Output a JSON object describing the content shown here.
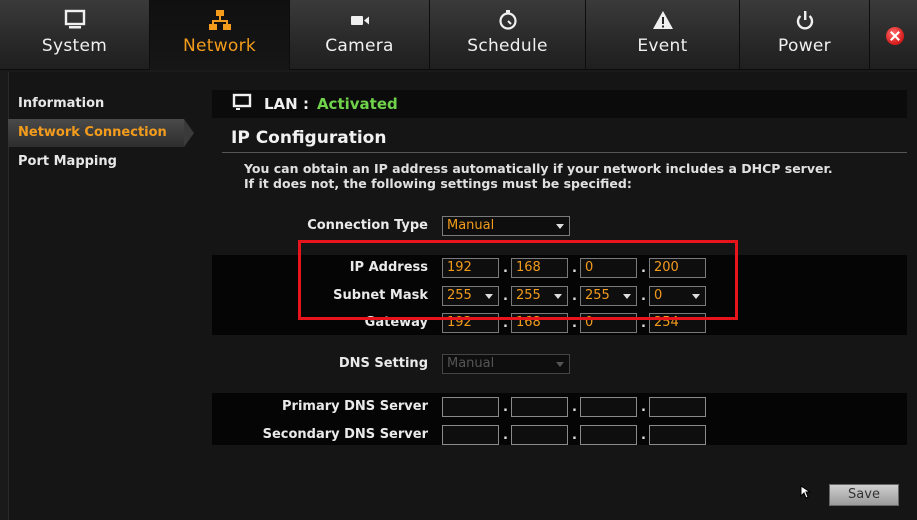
{
  "nav": {
    "tabs": [
      {
        "label": "System",
        "icon": "monitor-icon"
      },
      {
        "label": "Network",
        "icon": "network-icon",
        "active": true
      },
      {
        "label": "Camera",
        "icon": "camera-icon"
      },
      {
        "label": "Schedule",
        "icon": "clock-icon"
      },
      {
        "label": "Event",
        "icon": "warning-icon"
      },
      {
        "label": "Power",
        "icon": "power-icon"
      }
    ],
    "close_icon": "close-icon"
  },
  "sidebar": {
    "items": [
      {
        "label": "Information"
      },
      {
        "label": "Network Connection",
        "active": true
      },
      {
        "label": "Port Mapping"
      }
    ]
  },
  "lan": {
    "label": "LAN :",
    "status": "Activated",
    "status_color": "#6fd24a"
  },
  "ip_config": {
    "title": "IP Configuration",
    "desc_line1": "You can obtain an IP address automatically if your network includes a DHCP server.",
    "desc_line2": "If it does not, the following settings must be specified:",
    "connection_type_label": "Connection Type",
    "connection_type_value": "Manual",
    "ip_address_label": "IP Address",
    "ip_address": [
      "192",
      "168",
      "0",
      "200"
    ],
    "subnet_mask_label": "Subnet Mask",
    "subnet_mask": [
      "255",
      "255",
      "255",
      "0"
    ],
    "gateway_label": "Gateway",
    "gateway": [
      "192",
      "168",
      "0",
      "254"
    ],
    "dns_setting_label": "DNS Setting",
    "dns_setting_value": "Manual",
    "primary_dns_label": "Primary DNS Server",
    "secondary_dns_label": "Secondary DNS Server"
  },
  "actions": {
    "save_label": "Save"
  },
  "colors": {
    "accent": "#f39c1c",
    "highlight": "#e8141b"
  }
}
